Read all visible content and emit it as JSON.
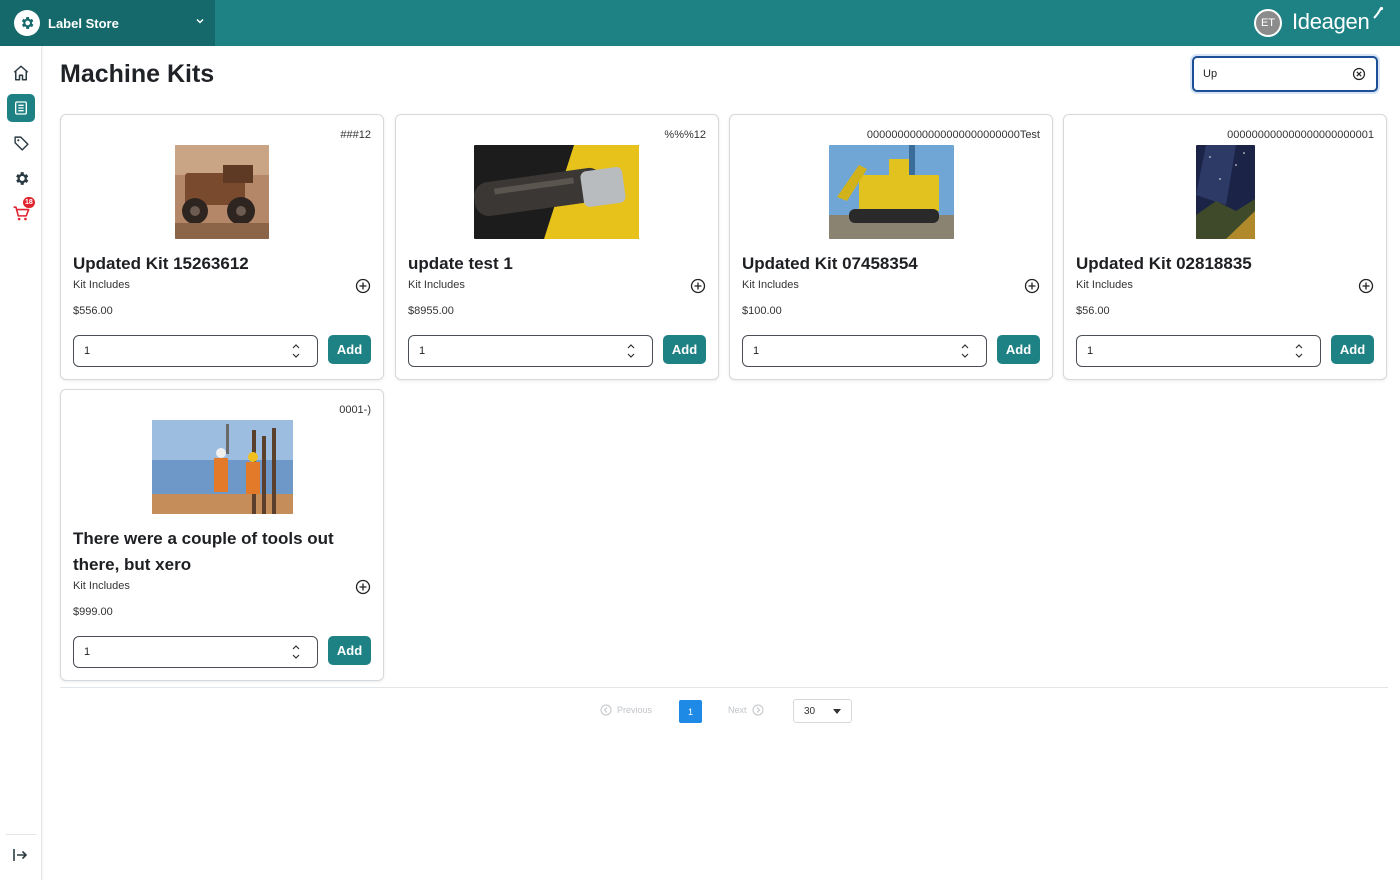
{
  "header": {
    "store_name": "Label Store",
    "user_initials": "ET",
    "brand": "Ideagen"
  },
  "sidebar": {
    "items": [
      {
        "name": "home",
        "icon": "home-icon"
      },
      {
        "name": "catalog",
        "icon": "list-icon",
        "active": true
      },
      {
        "name": "labels",
        "icon": "tag-icon"
      },
      {
        "name": "settings",
        "icon": "gear-icon"
      },
      {
        "name": "cart",
        "icon": "cart-icon",
        "badge": "18"
      }
    ],
    "exit_icon": "exit-icon"
  },
  "page": {
    "title": "Machine Kits"
  },
  "search": {
    "value": "Up",
    "placeholder": ""
  },
  "cards": [
    {
      "code": "###12",
      "name": "Updated Kit 15263612",
      "includes_label": "Kit Includes",
      "price": "$556.00",
      "qty": "1",
      "add_label": "Add"
    },
    {
      "code": "%%%12",
      "name": "update test 1",
      "includes_label": "Kit Includes",
      "price": "$8955.00",
      "qty": "1",
      "add_label": "Add"
    },
    {
      "code": "0000000000000000000000000Test",
      "name": "Updated Kit 07458354",
      "includes_label": "Kit Includes",
      "price": "$100.00",
      "qty": "1",
      "add_label": "Add"
    },
    {
      "code": "000000000000000000000001",
      "name": "Updated Kit 02818835",
      "includes_label": "Kit Includes",
      "price": "$56.00",
      "qty": "1",
      "add_label": "Add"
    },
    {
      "code": "0001-)",
      "name": "There were a couple of tools out there, but xero",
      "includes_label": "Kit Includes",
      "price": "$999.00",
      "qty": "1",
      "add_label": "Add"
    }
  ],
  "pagination": {
    "previous_label": "Previous",
    "current_page": "1",
    "next_label": "Next",
    "page_size": "30"
  },
  "colors": {
    "brand_teal": "#1e8284",
    "brand_teal_dark": "#16696b",
    "search_focus": "#1c4f95",
    "pagination_active": "#1f8ae6",
    "badge_red": "#e0252f"
  }
}
